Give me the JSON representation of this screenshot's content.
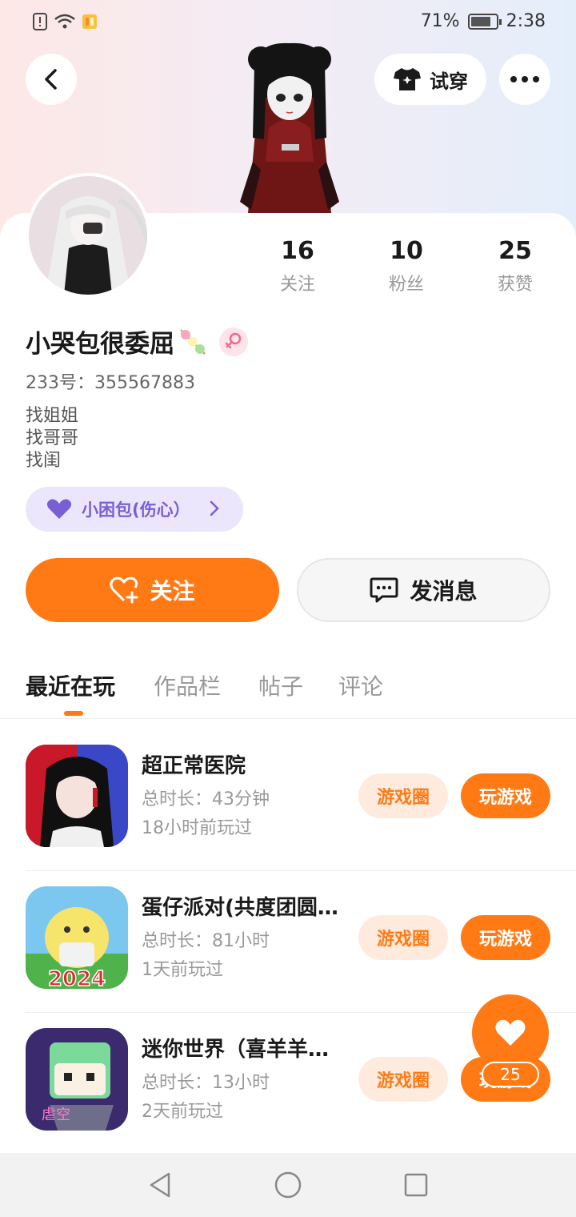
{
  "status_bar": {
    "battery_percent": "71%",
    "battery_level": 0.71,
    "time": "2:38"
  },
  "header": {
    "try_on_label": "试穿"
  },
  "stats": [
    {
      "value": "16",
      "label": "关注"
    },
    {
      "value": "10",
      "label": "粉丝"
    },
    {
      "value": "25",
      "label": "获赞"
    }
  ],
  "profile": {
    "nickname": "小哭包很委屈",
    "uid": "233号：355567883",
    "bio": [
      "找姐姐",
      "找哥哥",
      "找闺"
    ],
    "mood_tag": "小困包(伤心）"
  },
  "actions": {
    "follow_label": "关注",
    "message_label": "发消息"
  },
  "tabs": [
    "最近在玩",
    "作品栏",
    "帖子",
    "评论"
  ],
  "games": [
    {
      "title": "超正常医院",
      "duration": "总时长：43分钟",
      "last_played": "18小时前玩过",
      "circle_label": "游戏圈",
      "play_label": "玩游戏"
    },
    {
      "title": "蛋仔派对(共度团圆…",
      "duration": "总时长：81小时",
      "last_played": "1天前玩过",
      "circle_label": "游戏圈",
      "play_label": "玩游戏",
      "icon_text": "2024"
    },
    {
      "title": "迷你世界（喜羊羊…",
      "duration": "总时长：13小时",
      "last_played": "2天前玩过",
      "circle_label": "游戏圈",
      "play_label": "玩游戏",
      "icon_text": "虐空"
    }
  ],
  "like_fab": {
    "count": "25"
  },
  "colors": {
    "accent": "#ff7a14",
    "accent_light": "#ffebde",
    "mood_bg": "#ebe6fb",
    "mood_text": "#7a5fd2"
  }
}
